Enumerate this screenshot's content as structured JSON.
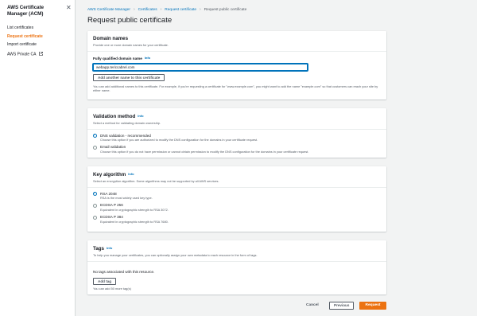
{
  "sidebar": {
    "title": "AWS Certificate Manager (ACM)",
    "close_glyph": "✕",
    "items": [
      {
        "label": "List certificates"
      },
      {
        "label": "Request certificate"
      },
      {
        "label": "Import certificate"
      },
      {
        "label": "AWS Private CA"
      }
    ]
  },
  "breadcrumb": {
    "items": [
      "AWS Certificate Manager",
      "Certificates",
      "Request certificate",
      "Request public certificate"
    ],
    "separator": "›"
  },
  "page_title": "Request public certificate",
  "domain_names": {
    "title": "Domain names",
    "description": "Provide one or more domain names for your certificate.",
    "field_label": "Fully qualified domain name",
    "info": "Info",
    "value": "webapp.tericcabrel.com",
    "add_button": "Add another name to this certificate",
    "help": "You can add additional names to this certificate. For example, if you're requesting a certificate for \"www.example.com\", you might want to add the name \"example.com\" so that customers can reach your site by either name."
  },
  "validation": {
    "title": "Validation method",
    "info": "Info",
    "description": "Select a method for validating domain ownership.",
    "options": [
      {
        "label": "DNS validation - recommended",
        "desc": "Choose this option if you are authorized to modify the DNS configuration for the domains in your certificate request.",
        "checked": true
      },
      {
        "label": "Email validation",
        "desc": "Choose this option if you do not have permission or cannot obtain permission to modify the DNS configuration for the domains in your certificate request.",
        "checked": false
      }
    ]
  },
  "key_algorithm": {
    "title": "Key algorithm",
    "info": "Info",
    "description": "Select an encryption algorithm. Some algorithms may not be supported by all AWS services.",
    "options": [
      {
        "label": "RSA 2048",
        "desc": "RSA is the most widely used key type.",
        "checked": true
      },
      {
        "label": "ECDSA P 256",
        "desc": "Equivalent in cryptographic strength to RSA 3072.",
        "checked": false
      },
      {
        "label": "ECDSA P 384",
        "desc": "Equivalent in cryptographic strength to RSA 7680.",
        "checked": false
      }
    ]
  },
  "tags": {
    "title": "Tags",
    "info": "Info",
    "description": "To help you manage your certificates, you can optionally assign your own metadata to each resource in the form of tags.",
    "empty": "No tags associated with this resource.",
    "add_button": "Add tag",
    "limit": "You can add 50 more tag(s)"
  },
  "footer": {
    "cancel": "Cancel",
    "previous": "Previous",
    "request": "Request"
  },
  "colors": {
    "accent": "#ec7211",
    "link": "#0073bb"
  }
}
